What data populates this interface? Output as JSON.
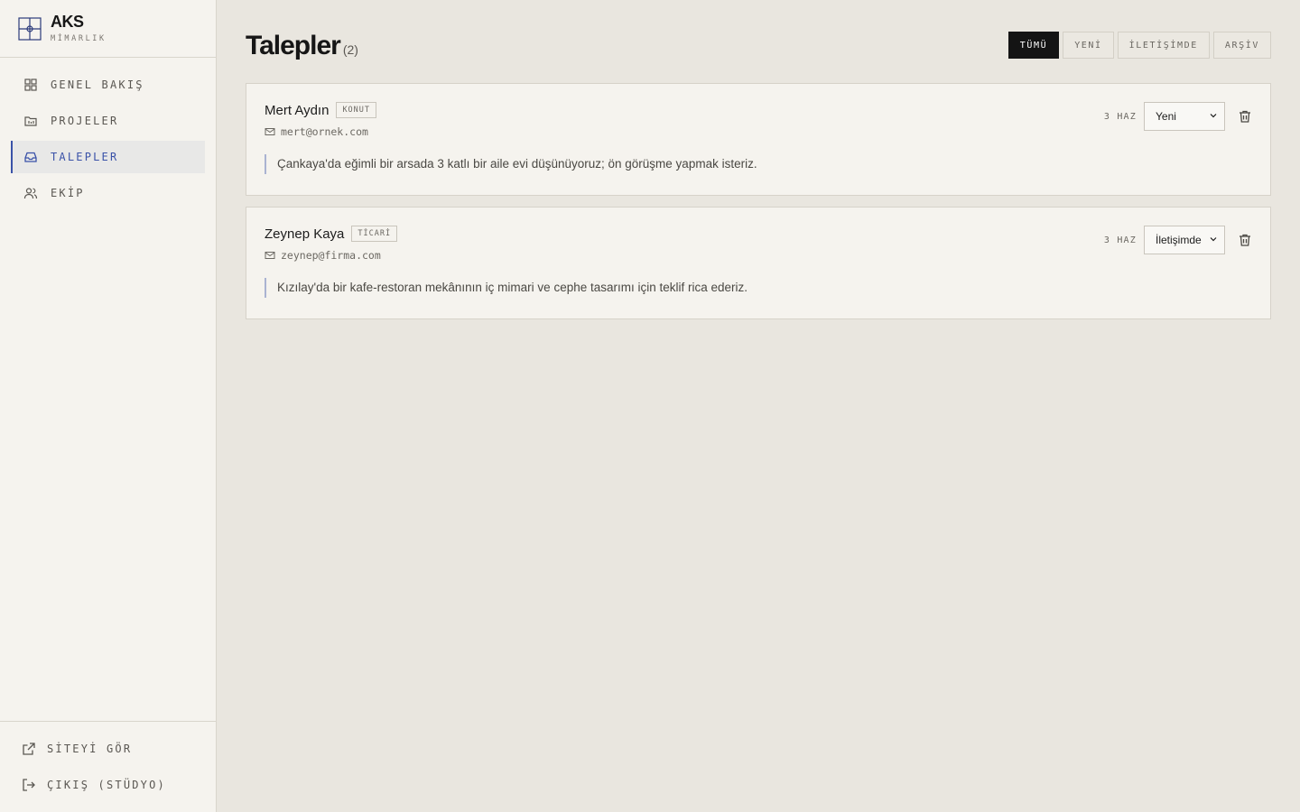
{
  "brand": {
    "name": "AKS",
    "subtitle": "MİMARLIK"
  },
  "sidebar": {
    "items": [
      {
        "label": "GENEL BAKIŞ",
        "icon": "grid-icon"
      },
      {
        "label": "PROJELER",
        "icon": "folder-icon"
      },
      {
        "label": "TALEPLER",
        "icon": "inbox-icon",
        "active": true
      },
      {
        "label": "EKİP",
        "icon": "users-icon"
      }
    ],
    "bottom": [
      {
        "label": "SİTEYİ GÖR",
        "icon": "external-link-icon"
      },
      {
        "label": "ÇIKIŞ (STÜDYO)",
        "icon": "logout-icon"
      }
    ]
  },
  "page": {
    "title": "Talepler",
    "count": "(2)"
  },
  "filters": [
    "TÜMÜ",
    "YENİ",
    "İLETİŞİMDE",
    "ARŞİV"
  ],
  "requests": [
    {
      "name": "Mert Aydın",
      "tag": "KONUT",
      "email": "mert@ornek.com",
      "message": "Çankaya'da eğimli bir arsada 3 katlı bir aile evi düşünüyoruz; ön görüşme yapmak isteriz.",
      "date": "3 HAZ",
      "status": "Yeni"
    },
    {
      "name": "Zeynep Kaya",
      "tag": "TİCARİ",
      "email": "zeynep@firma.com",
      "message": "Kızılay'da bir kafe-restoran mekânının iç mimari ve cephe tasarımı için teklif rica ederiz.",
      "date": "3 HAZ",
      "status": "İletişimde"
    }
  ],
  "colors": {
    "accent": "#3a52a8",
    "dark": "#141414",
    "background": "#e9e6df",
    "panel": "#f5f3ee"
  }
}
